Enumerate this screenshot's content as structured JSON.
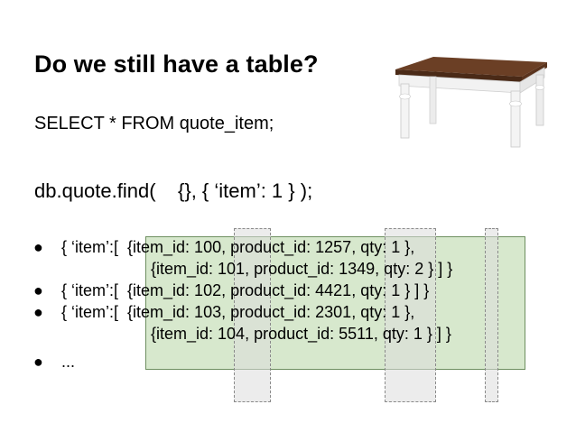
{
  "slide": {
    "title": "Do we still have a table?",
    "sql": "SELECT * FROM quote_item;",
    "find": "db.quote.find(    {}, { ‘item’: 1 } );",
    "lines": [
      {
        "bullet": "●",
        "text": "{ ‘item’:[  {item_id: 100, product_id: 1257, qty: 1 },"
      },
      {
        "bullet": "",
        "text": "{item_id: 101, product_id: 1349, qty: 2 } ] }"
      },
      {
        "bullet": "●",
        "text": "{ ‘item’:[  {item_id: 102, product_id: 4421, qty: 1 } ] }"
      },
      {
        "bullet": "●",
        "text": "{ ‘item’:[  {item_id: 103, product_id: 2301, qty: 1 },"
      },
      {
        "bullet": "",
        "text": "{item_id: 104, product_id: 5511, qty: 1 } ] }"
      },
      {
        "bullet": "●",
        "text": "..."
      }
    ]
  },
  "colors": {
    "highlight": "#c1dbb2",
    "column_marker": "#dcdcdc",
    "table_top": "#6b3f25"
  },
  "icons": {
    "table_image": "wooden-table-picture"
  }
}
